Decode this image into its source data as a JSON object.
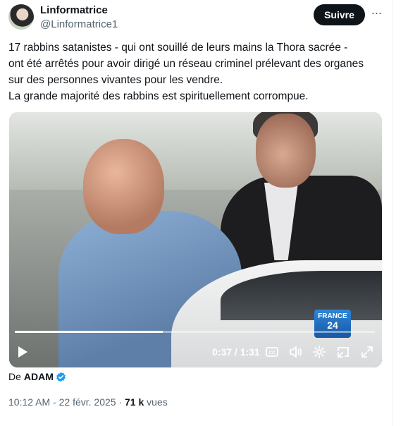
{
  "header": {
    "display_name": "Linformatrice",
    "handle": "@Linformatrice1",
    "follow_label": "Suivre",
    "more_label": "···"
  },
  "tweet": {
    "lines": [
      "17 rabbins satanistes - qui ont souillé de leurs mains la Thora sacrée -",
      "ont été arrêtés pour avoir dirigé un réseau criminel prélevant des organes",
      "sur des personnes vivantes pour les vendre.",
      "La grande majorité des rabbins est spirituellement corrompue."
    ]
  },
  "video": {
    "watermark_line1": "FRANCE",
    "watermark_line2": "24",
    "time_display": "0:37 / 1:31",
    "progress_fraction": 0.41,
    "icons": [
      "play-icon",
      "captions-icon",
      "volume-icon",
      "settings-icon",
      "pip-icon",
      "fullscreen-icon"
    ]
  },
  "attribution": {
    "prefix": "De",
    "author": "ADAM",
    "badge_color": "#1d9bf0"
  },
  "meta": {
    "time": "10:12 AM",
    "separator": "·",
    "date": "22 févr. 2025",
    "views_count": "71 k",
    "views_label": "vues"
  },
  "colors": {
    "text": "#0f1419",
    "secondary": "#536471",
    "follow_bg": "#0f1419"
  }
}
